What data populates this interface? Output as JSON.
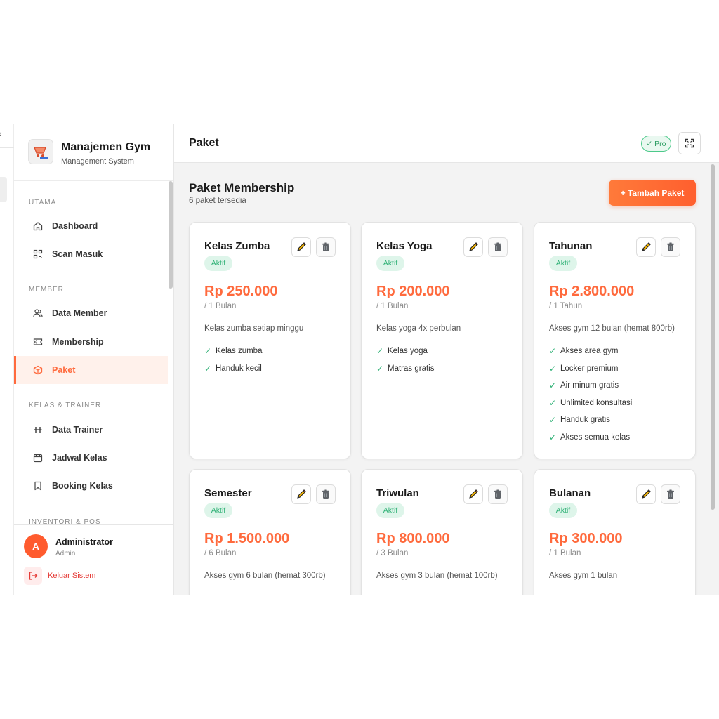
{
  "sidebar": {
    "brand_title": "Manajemen Gym",
    "brand_subtitle": "Management System",
    "sections": {
      "utama": "UTAMA",
      "member": "MEMBER",
      "kelas": "KELAS & TRAINER",
      "inventori": "INVENTORI & POS"
    },
    "items": {
      "dashboard": "Dashboard",
      "scan": "Scan Masuk",
      "data_member": "Data Member",
      "membership": "Membership",
      "paket": "Paket",
      "data_trainer": "Data Trainer",
      "jadwal": "Jadwal Kelas",
      "booking": "Booking Kelas"
    },
    "active_item": "paket",
    "user": {
      "initial": "A",
      "name": "Administrator",
      "role": "Admin"
    },
    "logout_label": "Keluar Sistem"
  },
  "header": {
    "title": "Paket",
    "pro_badge": "✓ Pro"
  },
  "main": {
    "heading": "Paket Membership",
    "subheading": "6 paket tersedia",
    "add_button": "+ Tambah Paket"
  },
  "packages": [
    {
      "name": "Kelas Zumba",
      "status": "Aktif",
      "price": "Rp 250.000",
      "period": "/ 1 Bulan",
      "description": "Kelas zumba setiap minggu",
      "features": [
        "Kelas zumba",
        "Handuk kecil"
      ]
    },
    {
      "name": "Kelas Yoga",
      "status": "Aktif",
      "price": "Rp 200.000",
      "period": "/ 1 Bulan",
      "description": "Kelas yoga 4x perbulan",
      "features": [
        "Kelas yoga",
        "Matras gratis"
      ]
    },
    {
      "name": "Tahunan",
      "status": "Aktif",
      "price": "Rp 2.800.000",
      "period": "/ 1 Tahun",
      "description": "Akses gym 12 bulan (hemat 800rb)",
      "features": [
        "Akses area gym",
        "Locker premium",
        "Air minum gratis",
        "Unlimited konsultasi",
        "Handuk gratis",
        "Akses semua kelas"
      ]
    },
    {
      "name": "Semester",
      "status": "Aktif",
      "price": "Rp 1.500.000",
      "period": "/ 6 Bulan",
      "description": "Akses gym 6 bulan (hemat 300rb)",
      "features": []
    },
    {
      "name": "Triwulan",
      "status": "Aktif",
      "price": "Rp 800.000",
      "period": "/ 3 Bulan",
      "description": "Akses gym 3 bulan (hemat 100rb)",
      "features": []
    },
    {
      "name": "Bulanan",
      "status": "Aktif",
      "price": "Rp 300.000",
      "period": "/ 1 Bulan",
      "description": "Akses gym 1 bulan",
      "features": []
    }
  ],
  "colors": {
    "accent": "#ff6a3d",
    "success": "#2fb176",
    "danger": "#e53935"
  }
}
